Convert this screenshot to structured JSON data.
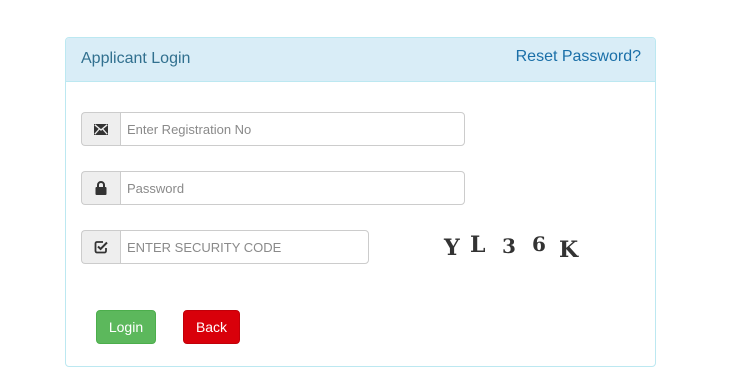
{
  "panel": {
    "title": "Applicant Login",
    "reset_link": "Reset Password?"
  },
  "fields": {
    "registration": {
      "placeholder": "Enter Registration No",
      "value": "",
      "icon": "envelope-icon"
    },
    "password": {
      "placeholder": "Password",
      "value": "",
      "icon": "lock-icon"
    },
    "security_code": {
      "placeholder": "ENTER SECURITY CODE",
      "value": "",
      "icon": "checkbox-edit-icon"
    }
  },
  "captcha": {
    "text": "YL36K",
    "chars": [
      "Y",
      "L",
      "3",
      "6",
      "K"
    ]
  },
  "buttons": {
    "login": "Login",
    "back": "Back"
  },
  "colors": {
    "heading_bg": "#d9edf7",
    "heading_text": "#31708f",
    "link": "#1a6fa8",
    "login_btn": "#5cb85c",
    "back_btn": "#d9000a"
  }
}
